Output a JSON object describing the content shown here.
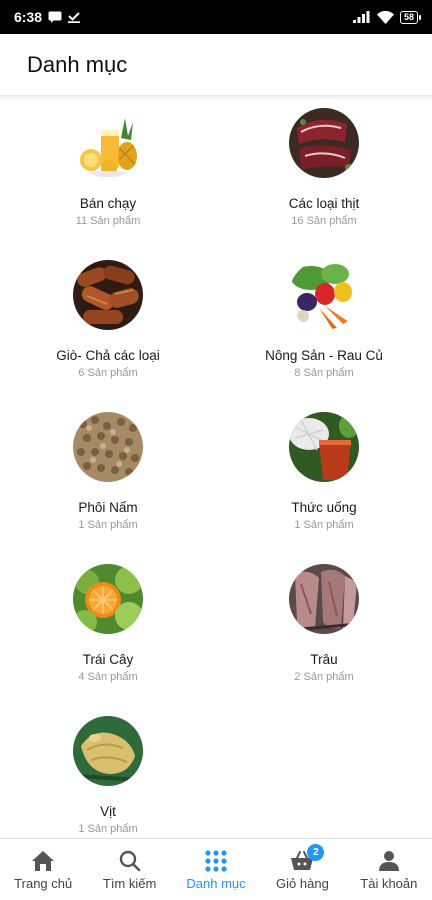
{
  "status_bar": {
    "time": "6:38",
    "battery": "58"
  },
  "header": {
    "title": "Danh mục"
  },
  "categories": [
    {
      "name": "Bán chạy",
      "count": "11 Sản phẩm",
      "image": "juice-pineapple-image"
    },
    {
      "name": "Các loại thịt",
      "count": "16 Sản phẩm",
      "image": "meat-image"
    },
    {
      "name": "Giò- Chả các loại",
      "count": "6 Sản phẩm",
      "image": "sausage-image"
    },
    {
      "name": "Nông Sản - Rau Củ",
      "count": "8 Sản phẩm",
      "image": "vegetables-image"
    },
    {
      "name": "Phôi Nấm",
      "count": "1 Sản phẩm",
      "image": "mushroom-spawn-image"
    },
    {
      "name": "Thức uống",
      "count": "1 Sản phẩm",
      "image": "drink-image"
    },
    {
      "name": "Trái Cây",
      "count": "4 Sản phẩm",
      "image": "fruit-image"
    },
    {
      "name": "Trâu",
      "count": "2 Sản phẩm",
      "image": "buffalo-meat-image"
    },
    {
      "name": "Vịt",
      "count": "1 Sản phẩm",
      "image": "duck-image"
    }
  ],
  "bottom_nav": {
    "items": [
      {
        "label": "Trang chủ",
        "icon": "home-icon"
      },
      {
        "label": "Tìm kiếm",
        "icon": "search-icon"
      },
      {
        "label": "Danh mục",
        "icon": "grid-icon",
        "active": true
      },
      {
        "label": "Giỏ hàng",
        "icon": "cart-icon",
        "badge": "2"
      },
      {
        "label": "Tài khoản",
        "icon": "account-icon"
      }
    ]
  },
  "colors": {
    "accent": "#2196f3",
    "text": "#222222",
    "muted": "#9a9a9a"
  }
}
